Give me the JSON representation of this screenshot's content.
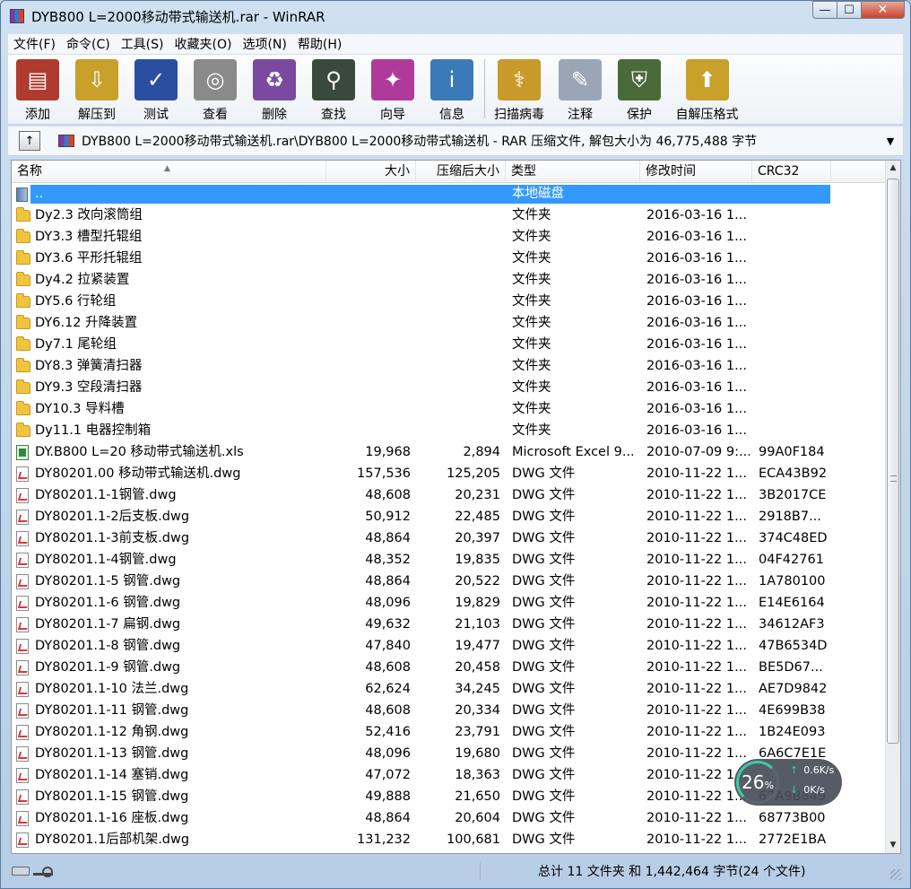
{
  "window": {
    "title": "DYB800 L=2000移动带式输送机.rar - WinRAR"
  },
  "window_controls": {
    "minimize": "—",
    "maximize": "☐",
    "close": "✕"
  },
  "menu": [
    "文件(F)",
    "命令(C)",
    "工具(S)",
    "收藏夹(O)",
    "选项(N)",
    "帮助(H)"
  ],
  "toolbar": [
    {
      "label": "添加",
      "icon": "add-archive-icon",
      "color": "#b03a2e",
      "glyph": "▤"
    },
    {
      "label": "解压到",
      "icon": "extract-to-icon",
      "color": "#c8a02a",
      "glyph": "⇩"
    },
    {
      "label": "测试",
      "icon": "test-icon",
      "color": "#2a4fa0",
      "glyph": "✓"
    },
    {
      "label": "查看",
      "icon": "view-icon",
      "color": "#8a8a8a",
      "glyph": "◎"
    },
    {
      "label": "删除",
      "icon": "delete-icon",
      "color": "#7a4aa0",
      "glyph": "♻"
    },
    {
      "label": "查找",
      "icon": "find-icon",
      "color": "#3a4a3a",
      "glyph": "⚲"
    },
    {
      "label": "向导",
      "icon": "wizard-icon",
      "color": "#b03a9a",
      "glyph": "✦"
    },
    {
      "label": "信息",
      "icon": "info-icon",
      "color": "#3a7ab8",
      "glyph": "i"
    },
    {
      "label": "扫描病毒",
      "icon": "virus-scan-icon",
      "color": "#c89a2a",
      "glyph": "⚕"
    },
    {
      "label": "注释",
      "icon": "comment-icon",
      "color": "#9aa6b8",
      "glyph": "✎"
    },
    {
      "label": "保护",
      "icon": "protect-icon",
      "color": "#4a6a3a",
      "glyph": "⛨"
    },
    {
      "label": "自解压格式",
      "icon": "sfx-icon",
      "color": "#c8a02a",
      "glyph": "⬆"
    }
  ],
  "address": {
    "up_label": "↑",
    "path": "DYB800 L=2000移动带式输送机.rar\\DYB800 L=2000移动带式输送机 - RAR 压缩文件, 解包大小为 46,775,488 字节",
    "dropdown": "▼"
  },
  "columns": {
    "name": "名称",
    "size": "大小",
    "packed": "压缩后大小",
    "type": "类型",
    "modified": "修改时间",
    "crc": "CRC32",
    "sort_caret": "▲"
  },
  "files": [
    {
      "icon": "up",
      "name": "..",
      "size": "",
      "packed": "",
      "type": "本地磁盘",
      "modified": "",
      "crc": "",
      "selected": true
    },
    {
      "icon": "folder",
      "name": "Dy2.3 改向滚筒组",
      "size": "",
      "packed": "",
      "type": "文件夹",
      "modified": "2016-03-16 1...",
      "crc": ""
    },
    {
      "icon": "folder",
      "name": "DY3.3 槽型托辊组",
      "size": "",
      "packed": "",
      "type": "文件夹",
      "modified": "2016-03-16 1...",
      "crc": ""
    },
    {
      "icon": "folder",
      "name": "DY3.6 平形托辊组",
      "size": "",
      "packed": "",
      "type": "文件夹",
      "modified": "2016-03-16 1...",
      "crc": ""
    },
    {
      "icon": "folder",
      "name": "Dy4.2 拉紧装置",
      "size": "",
      "packed": "",
      "type": "文件夹",
      "modified": "2016-03-16 1...",
      "crc": ""
    },
    {
      "icon": "folder",
      "name": "DY5.6 行轮组",
      "size": "",
      "packed": "",
      "type": "文件夹",
      "modified": "2016-03-16 1...",
      "crc": ""
    },
    {
      "icon": "folder",
      "name": "DY6.12 升降装置",
      "size": "",
      "packed": "",
      "type": "文件夹",
      "modified": "2016-03-16 1...",
      "crc": ""
    },
    {
      "icon": "folder",
      "name": "Dy7.1 尾轮组",
      "size": "",
      "packed": "",
      "type": "文件夹",
      "modified": "2016-03-16 1...",
      "crc": ""
    },
    {
      "icon": "folder",
      "name": "DY8.3 弹簧清扫器",
      "size": "",
      "packed": "",
      "type": "文件夹",
      "modified": "2016-03-16 1...",
      "crc": ""
    },
    {
      "icon": "folder",
      "name": "DY9.3 空段清扫器",
      "size": "",
      "packed": "",
      "type": "文件夹",
      "modified": "2016-03-16 1...",
      "crc": ""
    },
    {
      "icon": "folder",
      "name": "DY10.3 导料槽",
      "size": "",
      "packed": "",
      "type": "文件夹",
      "modified": "2016-03-16 1...",
      "crc": ""
    },
    {
      "icon": "folder",
      "name": "Dy11.1 电器控制箱",
      "size": "",
      "packed": "",
      "type": "文件夹",
      "modified": "2016-03-16 1...",
      "crc": ""
    },
    {
      "icon": "xls",
      "name": "DY.B800 L=20 移动带式输送机.xls",
      "size": "19,968",
      "packed": "2,894",
      "type": "Microsoft Excel 9...",
      "modified": "2010-07-09 9:...",
      "crc": "99A0F184"
    },
    {
      "icon": "dwg",
      "name": "DY80201.00 移动带式输送机.dwg",
      "size": "157,536",
      "packed": "125,205",
      "type": "DWG 文件",
      "modified": "2010-11-22 1...",
      "crc": "ECA43B92"
    },
    {
      "icon": "dwg",
      "name": "DY80201.1-1钢管.dwg",
      "size": "48,608",
      "packed": "20,231",
      "type": "DWG 文件",
      "modified": "2010-11-22 1...",
      "crc": "3B2017CE"
    },
    {
      "icon": "dwg",
      "name": "DY80201.1-2后支板.dwg",
      "size": "50,912",
      "packed": "22,485",
      "type": "DWG 文件",
      "modified": "2010-11-22 1...",
      "crc": "2918B7..."
    },
    {
      "icon": "dwg",
      "name": "DY80201.1-3前支板.dwg",
      "size": "48,864",
      "packed": "20,397",
      "type": "DWG 文件",
      "modified": "2010-11-22 1...",
      "crc": "374C48ED"
    },
    {
      "icon": "dwg",
      "name": "DY80201.1-4钢管.dwg",
      "size": "48,352",
      "packed": "19,835",
      "type": "DWG 文件",
      "modified": "2010-11-22 1...",
      "crc": "04F42761"
    },
    {
      "icon": "dwg",
      "name": "DY80201.1-5 钢管.dwg",
      "size": "48,864",
      "packed": "20,522",
      "type": "DWG 文件",
      "modified": "2010-11-22 1...",
      "crc": "1A780100"
    },
    {
      "icon": "dwg",
      "name": "DY80201.1-6 钢管.dwg",
      "size": "48,096",
      "packed": "19,829",
      "type": "DWG 文件",
      "modified": "2010-11-22 1...",
      "crc": "E14E6164"
    },
    {
      "icon": "dwg",
      "name": "DY80201.1-7 扁钢.dwg",
      "size": "49,632",
      "packed": "21,103",
      "type": "DWG 文件",
      "modified": "2010-11-22 1...",
      "crc": "34612AF3"
    },
    {
      "icon": "dwg",
      "name": "DY80201.1-8 钢管.dwg",
      "size": "47,840",
      "packed": "19,477",
      "type": "DWG 文件",
      "modified": "2010-11-22 1...",
      "crc": "47B6534D"
    },
    {
      "icon": "dwg",
      "name": "DY80201.1-9 钢管.dwg",
      "size": "48,608",
      "packed": "20,458",
      "type": "DWG 文件",
      "modified": "2010-11-22 1...",
      "crc": "BE5D67..."
    },
    {
      "icon": "dwg",
      "name": "DY80201.1-10 法兰.dwg",
      "size": "62,624",
      "packed": "34,245",
      "type": "DWG 文件",
      "modified": "2010-11-22 1...",
      "crc": "AE7D9842"
    },
    {
      "icon": "dwg",
      "name": "DY80201.1-11 钢管.dwg",
      "size": "48,608",
      "packed": "20,334",
      "type": "DWG 文件",
      "modified": "2010-11-22 1...",
      "crc": "4E699B38"
    },
    {
      "icon": "dwg",
      "name": "DY80201.1-12 角钢.dwg",
      "size": "52,416",
      "packed": "23,791",
      "type": "DWG 文件",
      "modified": "2010-11-22 1...",
      "crc": "1B24E093"
    },
    {
      "icon": "dwg",
      "name": "DY80201.1-13 钢管.dwg",
      "size": "48,096",
      "packed": "19,680",
      "type": "DWG 文件",
      "modified": "2010-11-22 1...",
      "crc": "6A6C7E1E"
    },
    {
      "icon": "dwg",
      "name": "DY80201.1-14 塞销.dwg",
      "size": "47,072",
      "packed": "18,363",
      "type": "DWG 文件",
      "modified": "2010-11-22 1...",
      "crc": ""
    },
    {
      "icon": "dwg",
      "name": "DY80201.1-15 钢管.dwg",
      "size": "49,888",
      "packed": "21,650",
      "type": "DWG 文件",
      "modified": "2010-11-22 1...",
      "crc": "67A9B849"
    },
    {
      "icon": "dwg",
      "name": "DY80201.1-16 座板.dwg",
      "size": "48,864",
      "packed": "20,604",
      "type": "DWG 文件",
      "modified": "2010-11-22 1...",
      "crc": "68773B00"
    },
    {
      "icon": "dwg",
      "name": "DY80201.1后部机架.dwg",
      "size": "131,232",
      "packed": "100,681",
      "type": "DWG 文件",
      "modified": "2010-11-22 1...",
      "crc": "2772E1BA"
    }
  ],
  "scrollbar": {
    "up": "▲",
    "down": "▼"
  },
  "netmon": {
    "percent": "26",
    "percent_sign": "%",
    "up_arrow": "↑",
    "up": "0.6K/s",
    "down_arrow": "↓",
    "down": "0K/s"
  },
  "status": {
    "summary": "总计 11 文件夹 和 1,442,464 字节(24 个文件)"
  }
}
